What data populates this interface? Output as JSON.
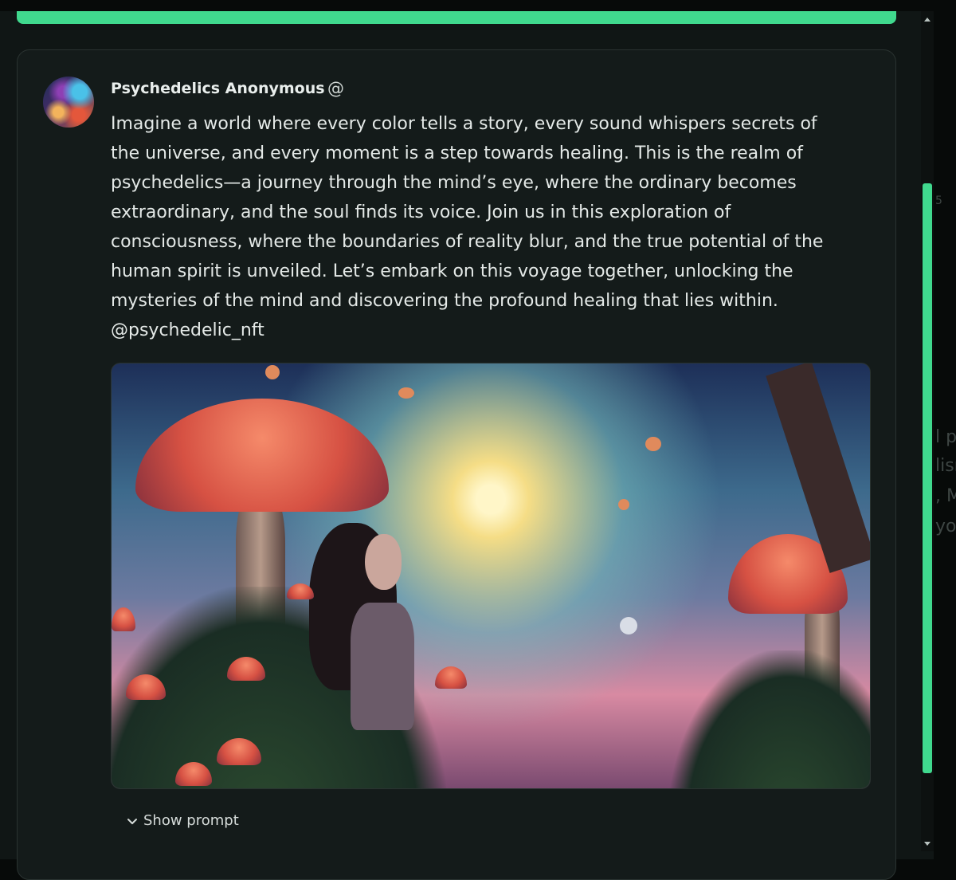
{
  "post": {
    "author_name": "Psychedelics Anonymous",
    "author_icon": "@",
    "body": "Imagine a world where every color tells a story, every sound whispers secrets of\nthe universe, and every moment is a step towards healing. This is the realm of\npsychedelics—a journey through the mind’s eye, where the ordinary becomes\nextraordinary, and the soul finds its voice. Join us in this exploration of\nconsciousness, where the boundaries of reality blur, and the true potential of the\nhuman spirit is unveiled. Let’s embark on this voyage together, unlocking the\nmysteries of the mind and discovering the profound healing that lies within.\n@psychedelic_nft",
    "show_prompt_label": "Show prompt"
  },
  "background_fragments": [
    "5",
    "l p",
    "lisı",
    ", M",
    "yo"
  ],
  "colors": {
    "accent": "#40d98e",
    "card_bg": "#141b1a",
    "page_bg": "#101615"
  },
  "progress": 1.0
}
